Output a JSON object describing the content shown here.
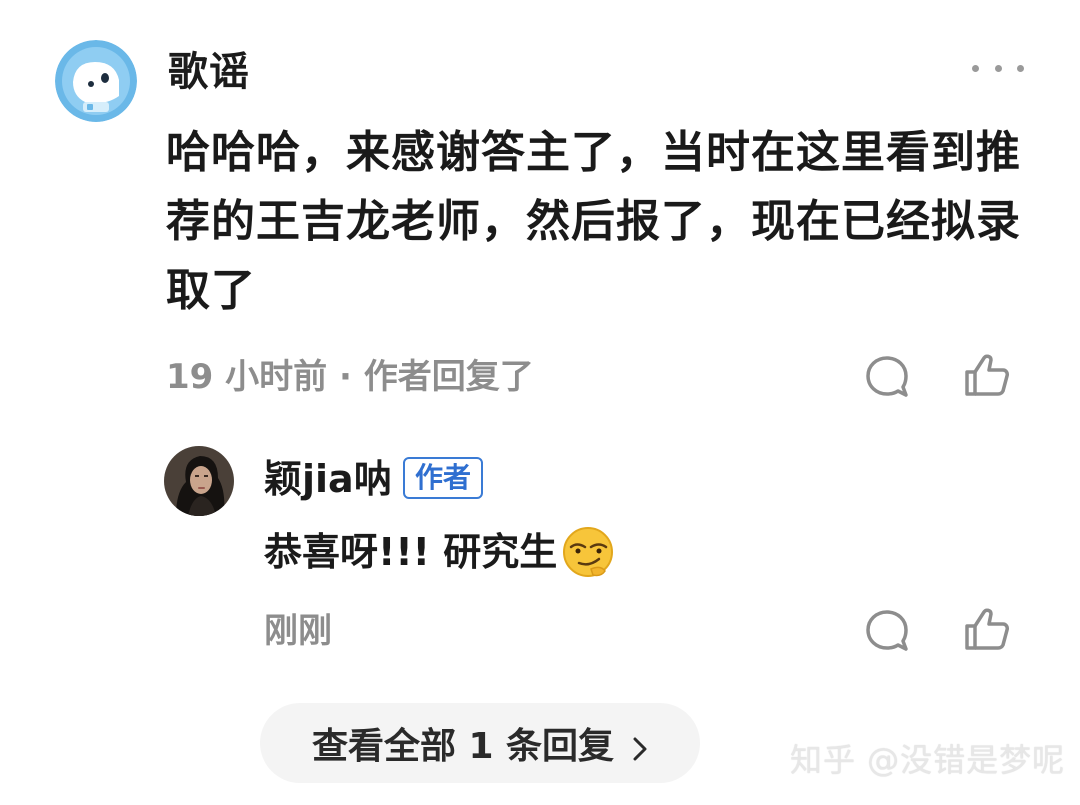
{
  "comment": {
    "author": "歌谣",
    "text": "哈哈哈，来感谢答主了，当时在这里看到推荐的王吉龙老师，然后报了，现在已经拟录取了",
    "meta": "19 小时前 · 作者回复了"
  },
  "reply": {
    "author": "颖jia呐",
    "badge": "作者",
    "text": "恭喜呀!!! 研究生",
    "meta": "刚刚"
  },
  "view_all": {
    "label": "查看全部 1 条回复"
  },
  "watermark": "知乎 @没错是梦呢",
  "icons": {
    "comment": "comment-bubble-icon",
    "like": "thumbs-up-icon",
    "more": "more-dots-icon",
    "chevron": "chevron-right-icon",
    "emoji": "smirk-emoji-icon"
  },
  "colors": {
    "badge": "#2f6fd0",
    "muted": "#8d8d8d",
    "text": "#1a1a1a"
  }
}
